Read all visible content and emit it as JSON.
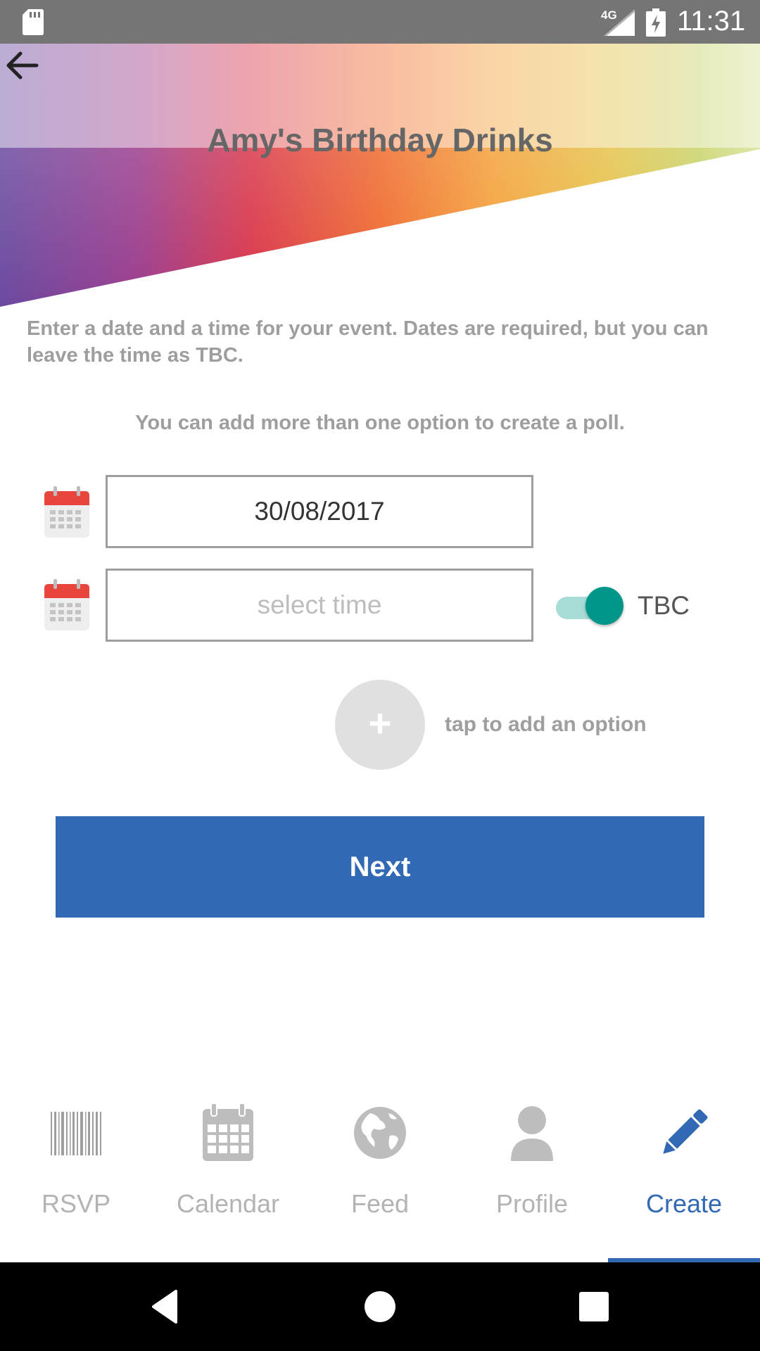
{
  "status_bar": {
    "network": "4G",
    "time": "11:31"
  },
  "header": {
    "title": "Amy's Birthday Drinks"
  },
  "instructions": "Enter a date and a time for your event.  Dates are required, but you can leave the time as TBC.",
  "poll_hint": "You can add more than one option to create a poll.",
  "date_field": {
    "value": "30/08/2017"
  },
  "time_field": {
    "placeholder": "select time"
  },
  "tbc_toggle": {
    "label": "TBC",
    "on": true
  },
  "add_option": {
    "symbol": "+",
    "label": "tap to add an option"
  },
  "next_button": {
    "label": "Next"
  },
  "bottom_nav": {
    "items": [
      {
        "label": "RSVP",
        "icon": "barcode-icon"
      },
      {
        "label": "Calendar",
        "icon": "calendar-icon"
      },
      {
        "label": "Feed",
        "icon": "globe-icon"
      },
      {
        "label": "Profile",
        "icon": "person-icon"
      },
      {
        "label": "Create",
        "icon": "pencil-icon",
        "active": true
      }
    ]
  },
  "colors": {
    "accent": "#3169b4",
    "toggle_on": "#00968a",
    "status_bar": "#757575"
  }
}
